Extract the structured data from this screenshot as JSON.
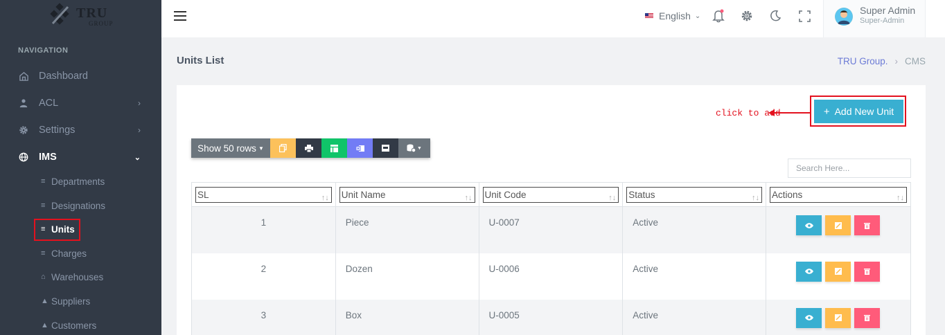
{
  "brand": {
    "name": "TRU",
    "sub": "GROUP"
  },
  "sidebar": {
    "title": "NAVIGATION",
    "items": [
      {
        "label": "Dashboard",
        "icon": "home-icon"
      },
      {
        "label": "ACL",
        "icon": "user-icon"
      },
      {
        "label": "Settings",
        "icon": "gear-icon"
      },
      {
        "label": "IMS",
        "icon": "globe-icon"
      }
    ],
    "subitems": [
      {
        "label": "Departments",
        "icon": "list-icon"
      },
      {
        "label": "Designations",
        "icon": "list-icon"
      },
      {
        "label": "Units",
        "icon": "list-icon"
      },
      {
        "label": "Charges",
        "icon": "list-icon"
      },
      {
        "label": "Warehouses",
        "icon": "home-icon"
      },
      {
        "label": "Suppliers",
        "icon": "user-icon"
      },
      {
        "label": "Customers",
        "icon": "user-icon"
      }
    ]
  },
  "topbar": {
    "language": "English",
    "user_name": "Super Admin",
    "user_role": "Super-Admin"
  },
  "page": {
    "title": "Units List",
    "breadcrumb": [
      "TRU Group.",
      "CMS"
    ]
  },
  "toolbar": {
    "show_rows": "Show 50 rows",
    "add_button": "Add New Unit",
    "annotation": "click to add",
    "search_placeholder": "Search Here...",
    "colors": {
      "copy": "#fcc15b",
      "print": "#323a46",
      "csv": "#10c469",
      "excel": "#727cf5",
      "pdf": "#323a46",
      "columns": "#6c757d",
      "show": "#6c757d"
    }
  },
  "table": {
    "headers": [
      "SL",
      "Unit Name",
      "Unit Code",
      "Status",
      "Actions"
    ],
    "rows": [
      {
        "sl": "1",
        "name": "Piece",
        "code": "U-0007",
        "status": "Active"
      },
      {
        "sl": "2",
        "name": "Dozen",
        "code": "U-0006",
        "status": "Active"
      },
      {
        "sl": "3",
        "name": "Box",
        "code": "U-0005",
        "status": "Active"
      }
    ],
    "action_colors": {
      "view": "#39afd1",
      "edit": "#ffbc4d",
      "delete": "#ff5b7a"
    }
  }
}
